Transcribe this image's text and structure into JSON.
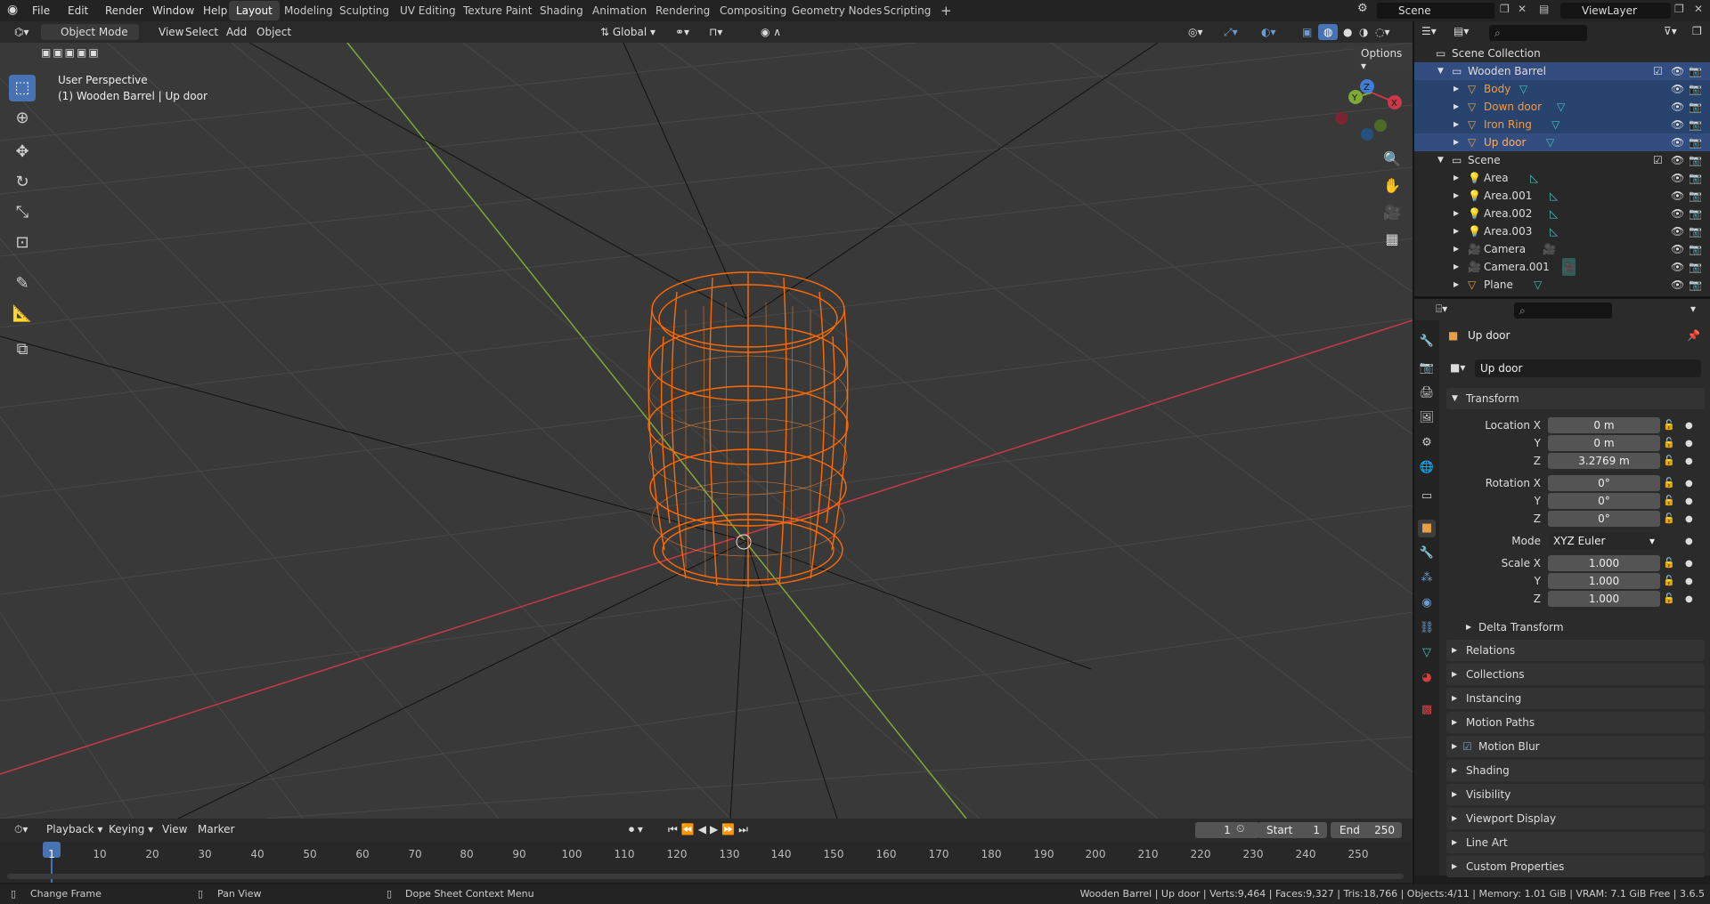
{
  "topbar": {
    "menus": [
      "File",
      "Edit",
      "Render",
      "Window",
      "Help"
    ],
    "workspaces": [
      "Layout",
      "Modeling",
      "Sculpting",
      "UV Editing",
      "Texture Paint",
      "Shading",
      "Animation",
      "Rendering",
      "Compositing",
      "Geometry Nodes",
      "Scripting"
    ],
    "active_workspace": "Layout",
    "scene": "Scene",
    "view_layer": "ViewLayer",
    "add_icon": "plus-icon"
  },
  "viewport_header": {
    "mode": "Object Mode",
    "menus": [
      "View",
      "Select",
      "Add",
      "Object"
    ],
    "orientation": "Global",
    "options": "Options"
  },
  "viewport": {
    "view_name": "User Perspective",
    "object_info": "(1) Wooden Barrel | Up door",
    "gizmo_labels": [
      "Z",
      "Y",
      "X"
    ],
    "colors": {
      "x_axis": "#c9394a",
      "y_axis": "#7fa839",
      "z_axis": "#3f7fd6",
      "object": "#ff6a00",
      "grid": "#4a4a4a",
      "bg": "#393939"
    }
  },
  "outliner": {
    "root": "Scene Collection",
    "collections": [
      {
        "name": "Wooden Barrel",
        "selected": true,
        "items": [
          "Body",
          "Down door",
          "Iron Ring",
          "Up door"
        ]
      },
      {
        "name": "Scene",
        "selected": false,
        "items": [
          "Area",
          "Area.001",
          "Area.002",
          "Area.003",
          "Camera",
          "Camera.001",
          "Plane"
        ]
      }
    ]
  },
  "properties": {
    "object_name": "Up door",
    "name_field": "Up door",
    "transform_title": "Transform",
    "location_label": "Location X",
    "rotation_label": "Rotation X",
    "scale_label": "Scale X",
    "axis_y": "Y",
    "axis_z": "Z",
    "location": [
      "0 m",
      "0 m",
      "3.2769 m"
    ],
    "rotation": [
      "0°",
      "0°",
      "0°"
    ],
    "mode_label": "Mode",
    "mode_value": "XYZ Euler",
    "scale": [
      "1.000",
      "1.000",
      "1.000"
    ],
    "delta_transform": "Delta Transform",
    "panels": [
      "Relations",
      "Collections",
      "Instancing",
      "Motion Paths",
      "Motion Blur",
      "Shading",
      "Visibility",
      "Viewport Display",
      "Line Art",
      "Custom Properties"
    ]
  },
  "timeline": {
    "menus": [
      "Playback",
      "Keying",
      "View",
      "Marker"
    ],
    "current_frame": "1",
    "start_label": "Start",
    "start": "1",
    "end_label": "End",
    "end": "250",
    "ticks": [
      "1",
      "10",
      "20",
      "30",
      "40",
      "50",
      "60",
      "70",
      "80",
      "90",
      "100",
      "110",
      "120",
      "130",
      "140",
      "150",
      "160",
      "170",
      "180",
      "190",
      "200",
      "210",
      "220",
      "230",
      "240",
      "250"
    ]
  },
  "statusbar": {
    "hint1": "Change Frame",
    "hint2": "Pan View",
    "hint3": "Dope Sheet Context Menu",
    "stats": "Wooden Barrel | Up door | Verts:9,464 | Faces:9,327 | Tris:18,766 | Objects:4/11 | Memory: 1.01 GiB | VRAM: 7.1 GiB Free | 3.6.5"
  }
}
